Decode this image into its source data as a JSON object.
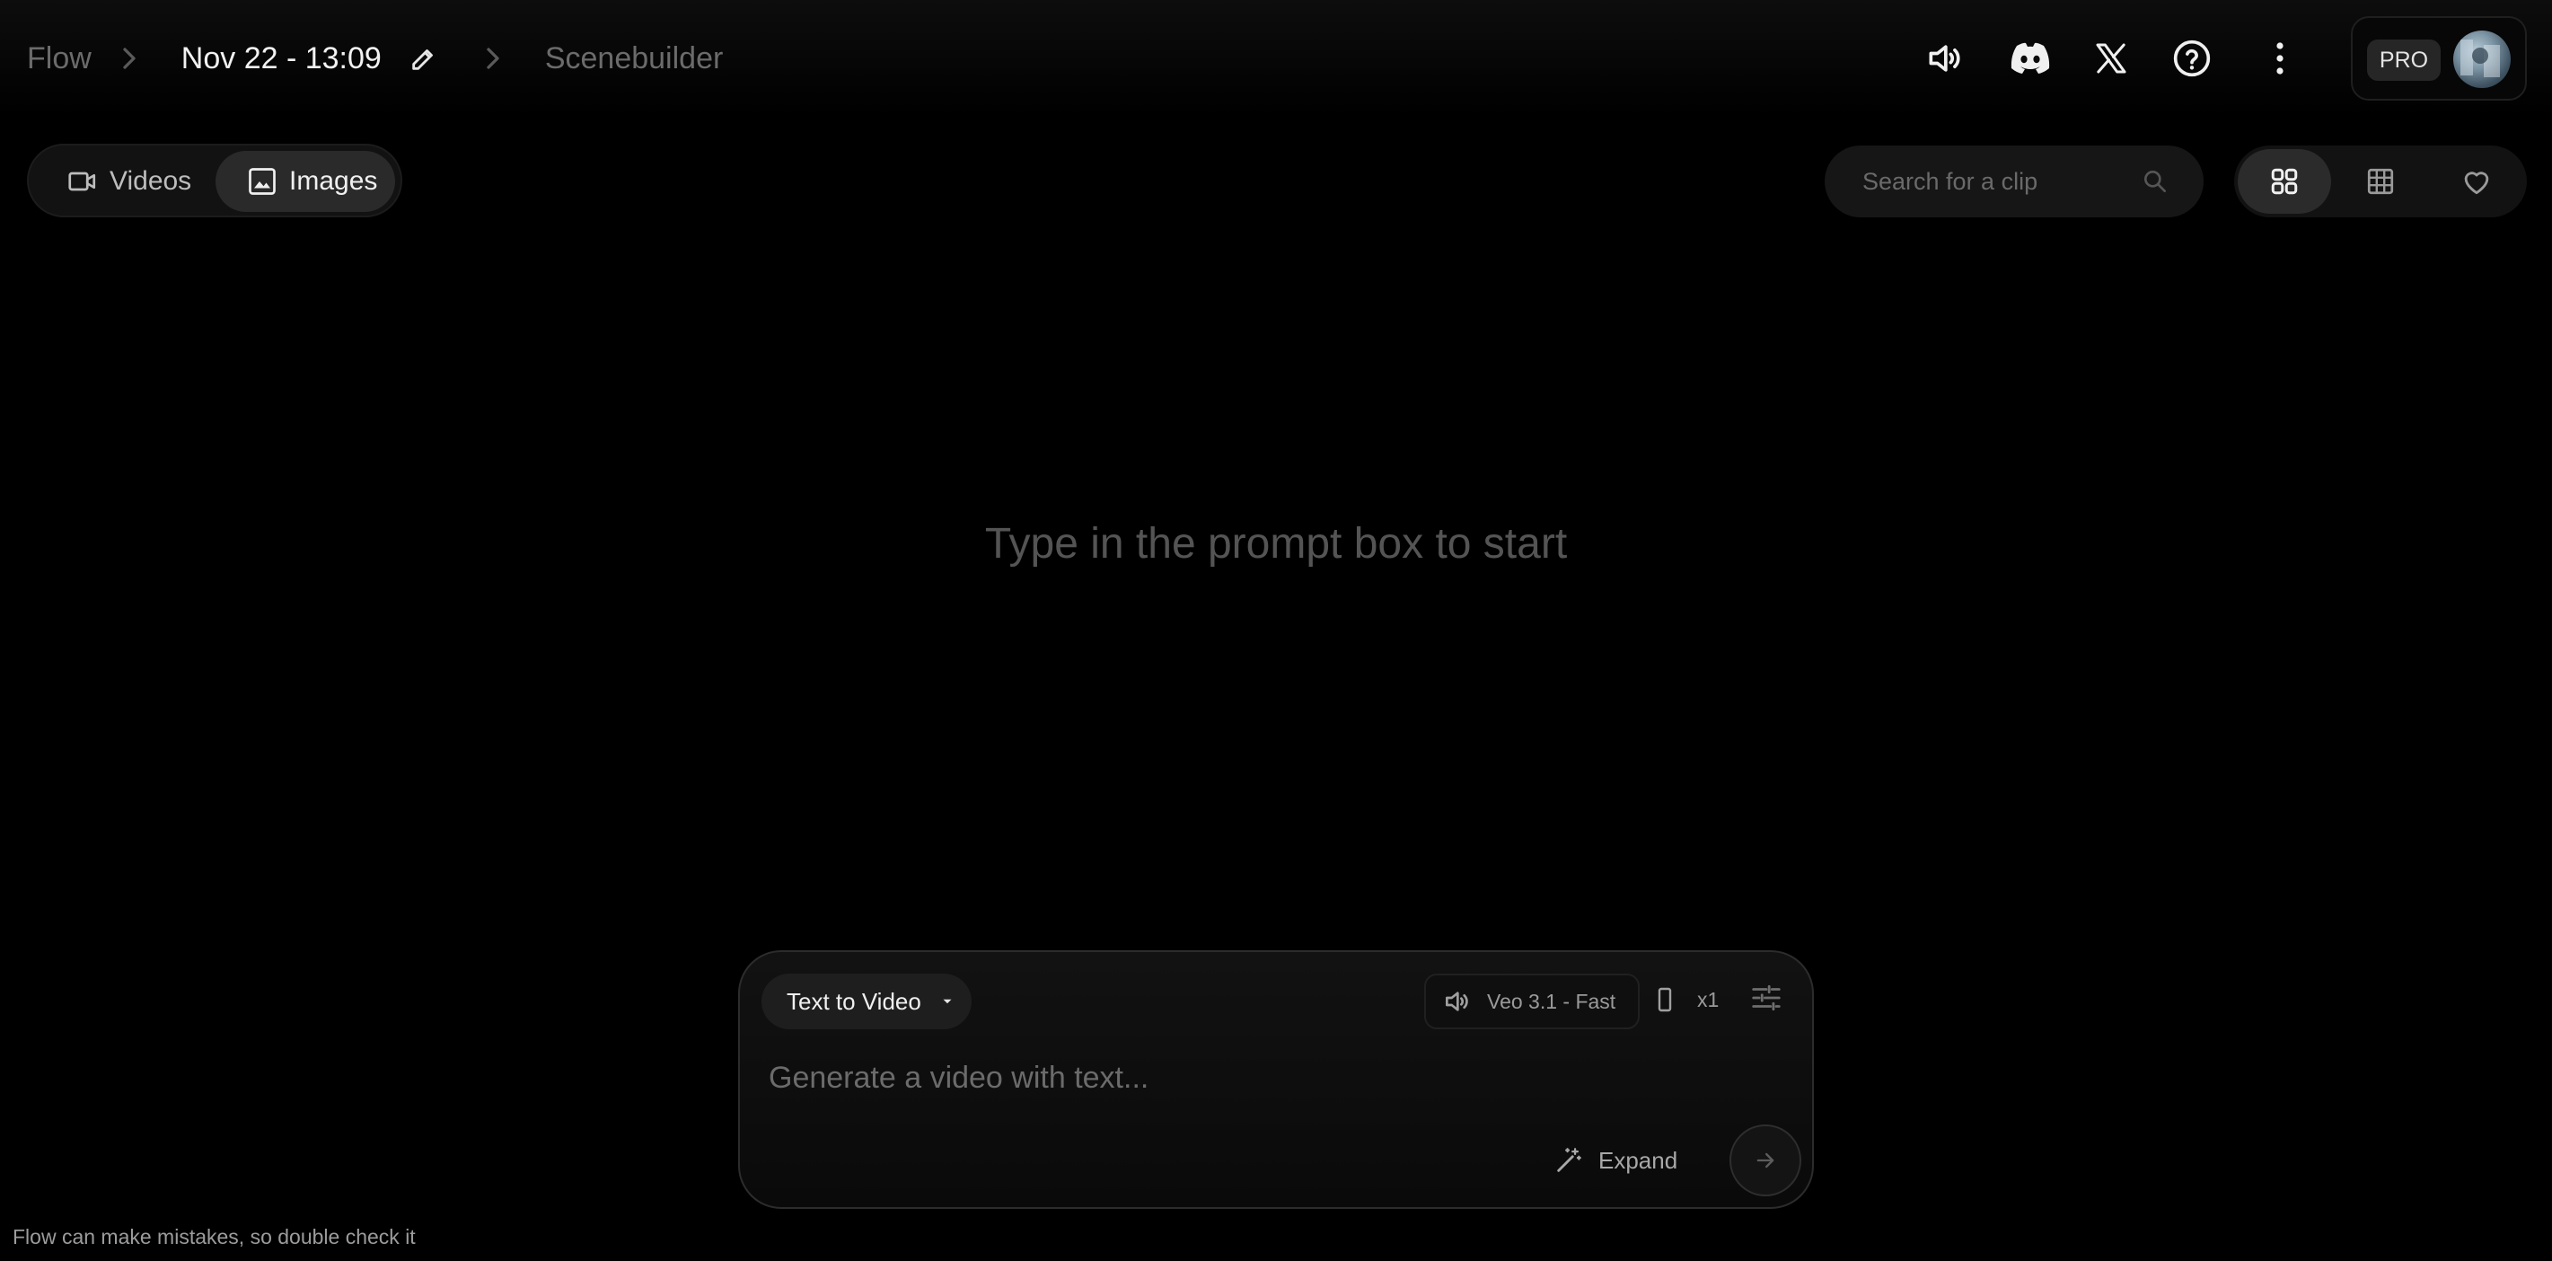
{
  "breadcrumb": {
    "root": "Flow",
    "project": "Nov 22 - 13:09",
    "section": "Scenebuilder"
  },
  "header": {
    "icons": [
      "volume-icon",
      "discord-icon",
      "x-icon",
      "help-icon",
      "more-vert-icon"
    ],
    "pro_badge": "PRO"
  },
  "tabs": [
    {
      "label": "Videos",
      "icon": "video-icon",
      "active": false
    },
    {
      "label": "Images",
      "icon": "image-icon",
      "active": true
    }
  ],
  "search": {
    "placeholder": "Search for a clip"
  },
  "views": [
    "grid-view-icon",
    "grid-small-view-icon",
    "favorites-icon"
  ],
  "empty_state": "Type in the prompt box to start",
  "composer": {
    "mode": "Text to Video",
    "model": "Veo 3.1 - Fast",
    "count": "x1",
    "placeholder": "Generate a video with text...",
    "expand": "Expand"
  },
  "disclaimer": "Flow can make mistakes, so double check it",
  "colors": {
    "background": "#000000",
    "accent_surface": "#2a2a2a"
  }
}
